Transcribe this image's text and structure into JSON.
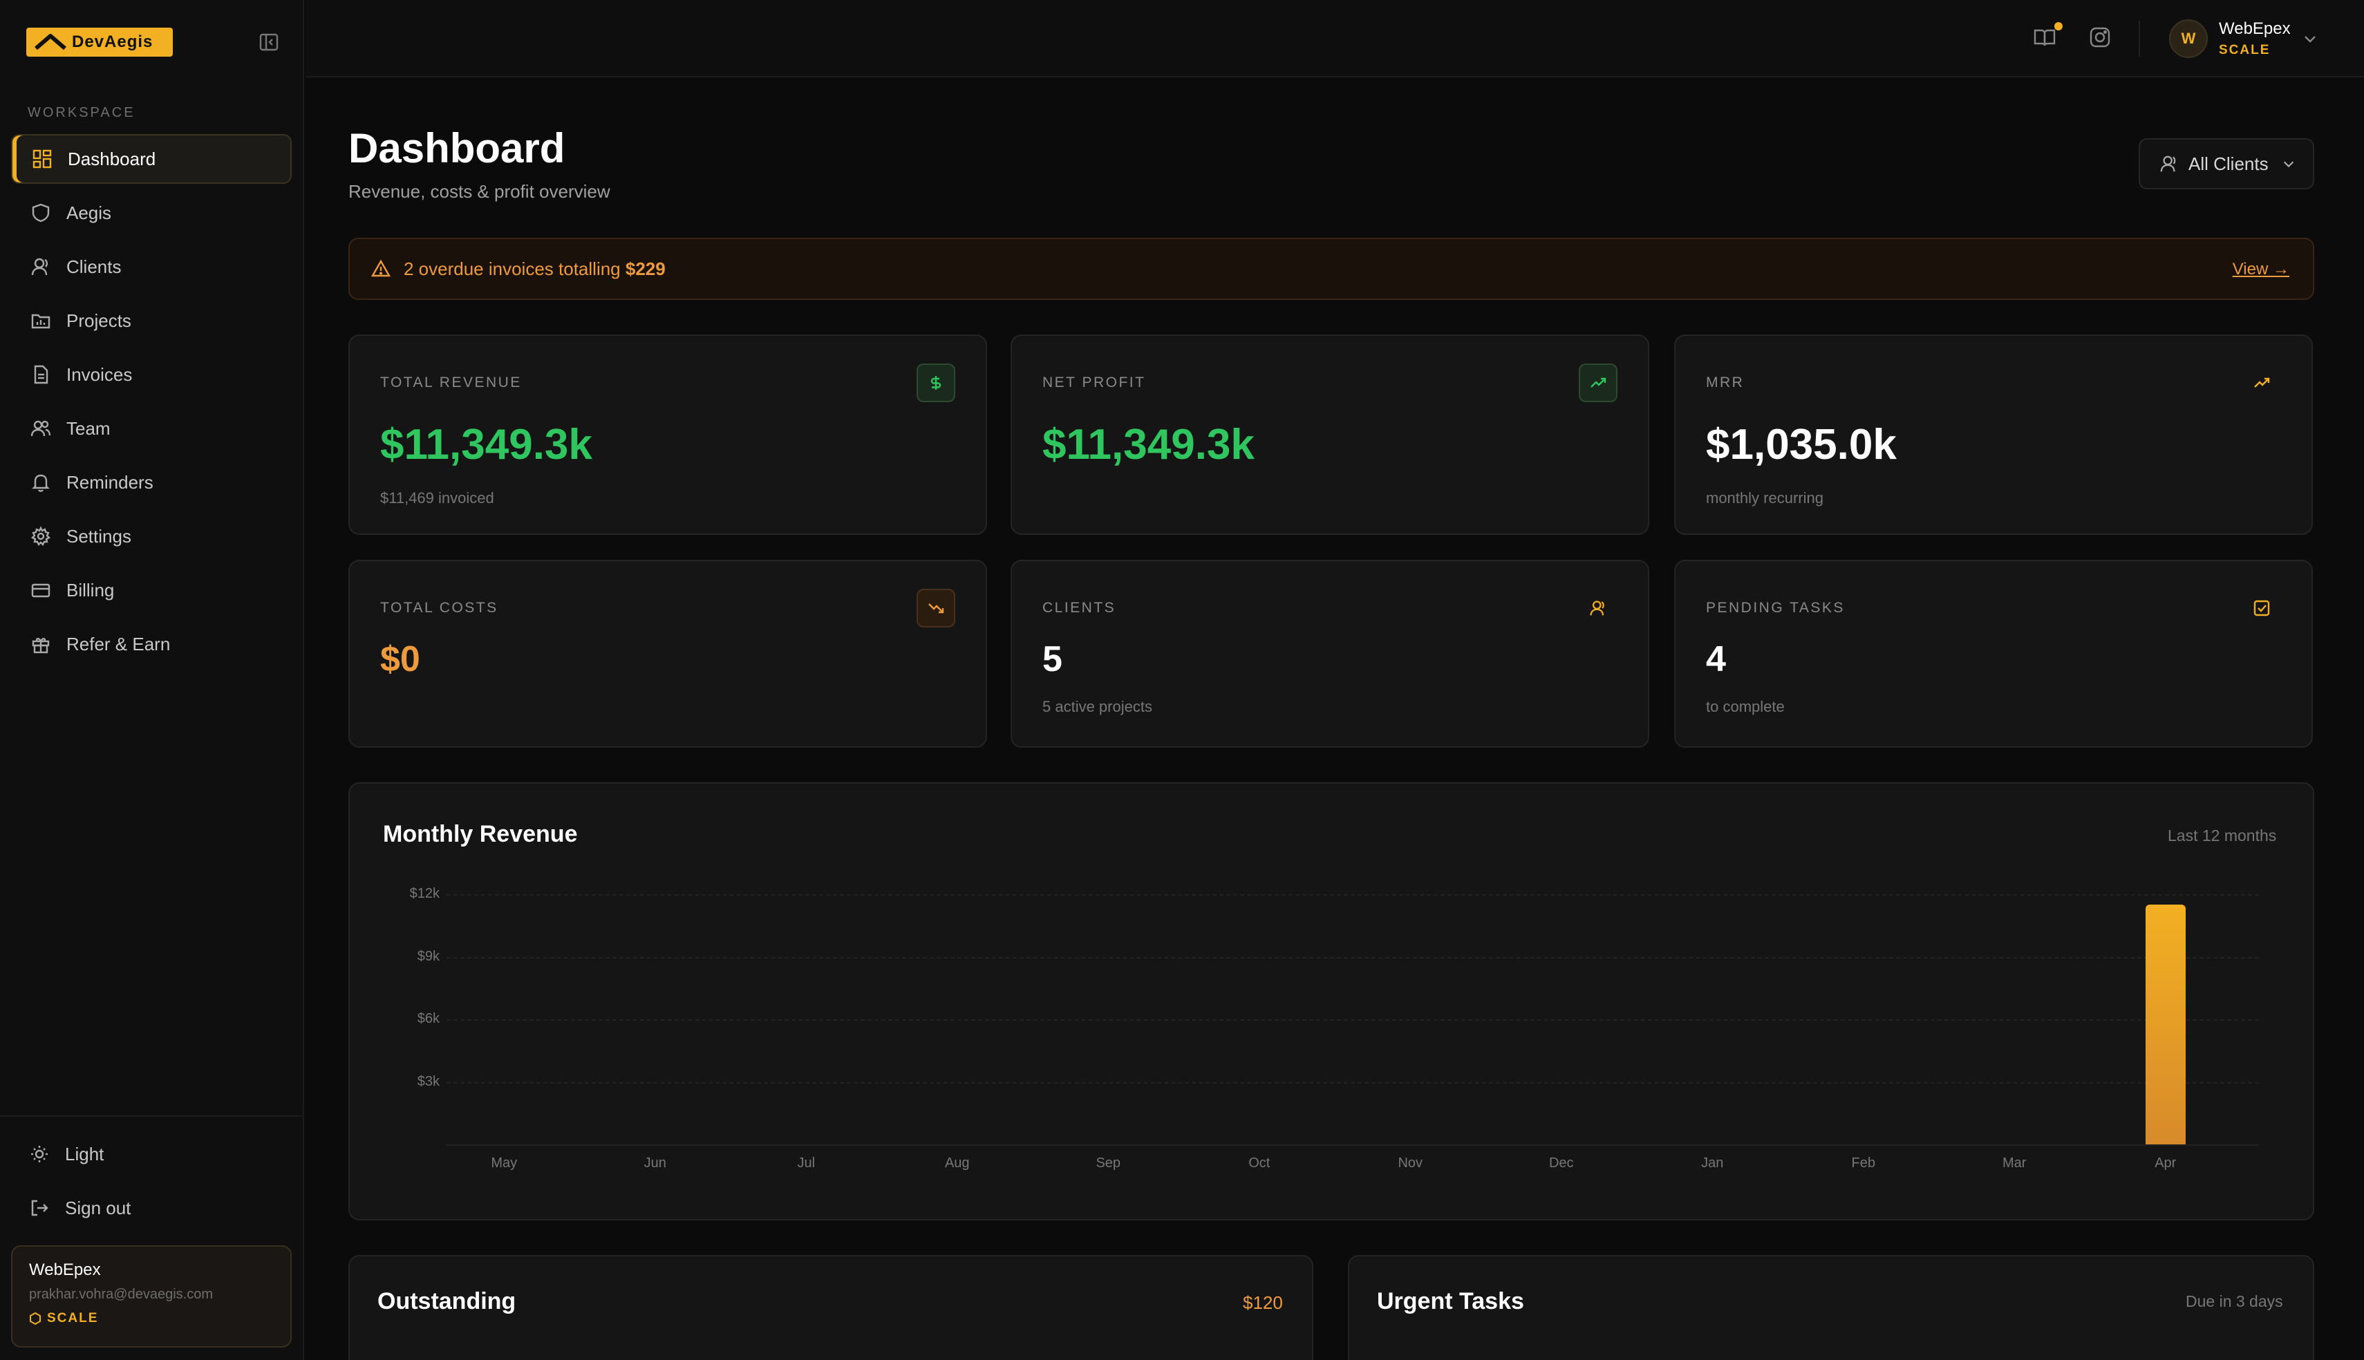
{
  "brand": {
    "name": "DevAegis"
  },
  "sidebar": {
    "section_label": "WORKSPACE",
    "items": [
      {
        "label": "Dashboard",
        "icon": "grid-icon",
        "active": true
      },
      {
        "label": "Aegis",
        "icon": "shield-icon"
      },
      {
        "label": "Clients",
        "icon": "user-icon"
      },
      {
        "label": "Projects",
        "icon": "folder-chart-icon"
      },
      {
        "label": "Invoices",
        "icon": "file-icon"
      },
      {
        "label": "Team",
        "icon": "users-icon"
      },
      {
        "label": "Reminders",
        "icon": "bell-icon"
      },
      {
        "label": "Settings",
        "icon": "gear-icon"
      },
      {
        "label": "Billing",
        "icon": "credit-card-icon"
      },
      {
        "label": "Refer & Earn",
        "icon": "gift-icon"
      }
    ],
    "theme_toggle": "Light",
    "sign_out": "Sign out",
    "account": {
      "name": "WebEpex",
      "email": "prakhar.vohra@devaegis.com",
      "plan": "SCALE"
    }
  },
  "topbar": {
    "user": {
      "initial": "W",
      "name": "WebEpex",
      "plan": "SCALE"
    }
  },
  "page": {
    "title": "Dashboard",
    "subtitle": "Revenue, costs & profit overview",
    "filter": "All Clients"
  },
  "alert": {
    "count_text": "2 overdue invoices totalling",
    "amount": "$229",
    "link": "View →"
  },
  "stats": [
    {
      "label": "TOTAL REVENUE",
      "value": "$11,349.3k",
      "note": "$11,469 invoiced",
      "color": "#2fc65f",
      "icon": "dollar-icon"
    },
    {
      "label": "NET PROFIT",
      "value": "$11,349.3k",
      "note": "",
      "color": "#2fc65f",
      "icon": "trend-up-icon"
    },
    {
      "label": "MRR",
      "value": "$1,035.0k",
      "note": "monthly recurring",
      "color": "#ffffff",
      "icon": "trend-up-icon"
    },
    {
      "label": "TOTAL COSTS",
      "value": "$0",
      "note": "",
      "color": "#ee9b3d",
      "icon": "trend-down-icon"
    },
    {
      "label": "CLIENTS",
      "value": "5",
      "note": "5 active projects",
      "color": "#ffffff",
      "icon": "user-icon"
    },
    {
      "label": "PENDING TASKS",
      "value": "4",
      "note": "to complete",
      "color": "#ffffff",
      "icon": "checkbox-icon"
    }
  ],
  "revenue_panel": {
    "title": "Monthly Revenue",
    "meta": "Last 12 months"
  },
  "chart_data": {
    "type": "bar",
    "title": "Monthly Revenue",
    "categories": [
      "May",
      "Jun",
      "Jul",
      "Aug",
      "Sep",
      "Oct",
      "Nov",
      "Dec",
      "Jan",
      "Feb",
      "Mar",
      "Apr"
    ],
    "values": [
      0,
      0,
      0,
      0,
      0,
      0,
      0,
      0,
      0,
      0,
      0,
      11500
    ],
    "y_ticks": [
      "$12k",
      "$9k",
      "$6k",
      "$3k"
    ],
    "y_tick_values": [
      12000,
      9000,
      6000,
      3000
    ],
    "ylim": [
      0,
      12000
    ],
    "grid": true,
    "bar_color": "#f2b022"
  },
  "outstanding": {
    "title": "Outstanding",
    "amount": "$120"
  },
  "urgent": {
    "title": "Urgent Tasks",
    "meta": "Due in 3 days"
  }
}
